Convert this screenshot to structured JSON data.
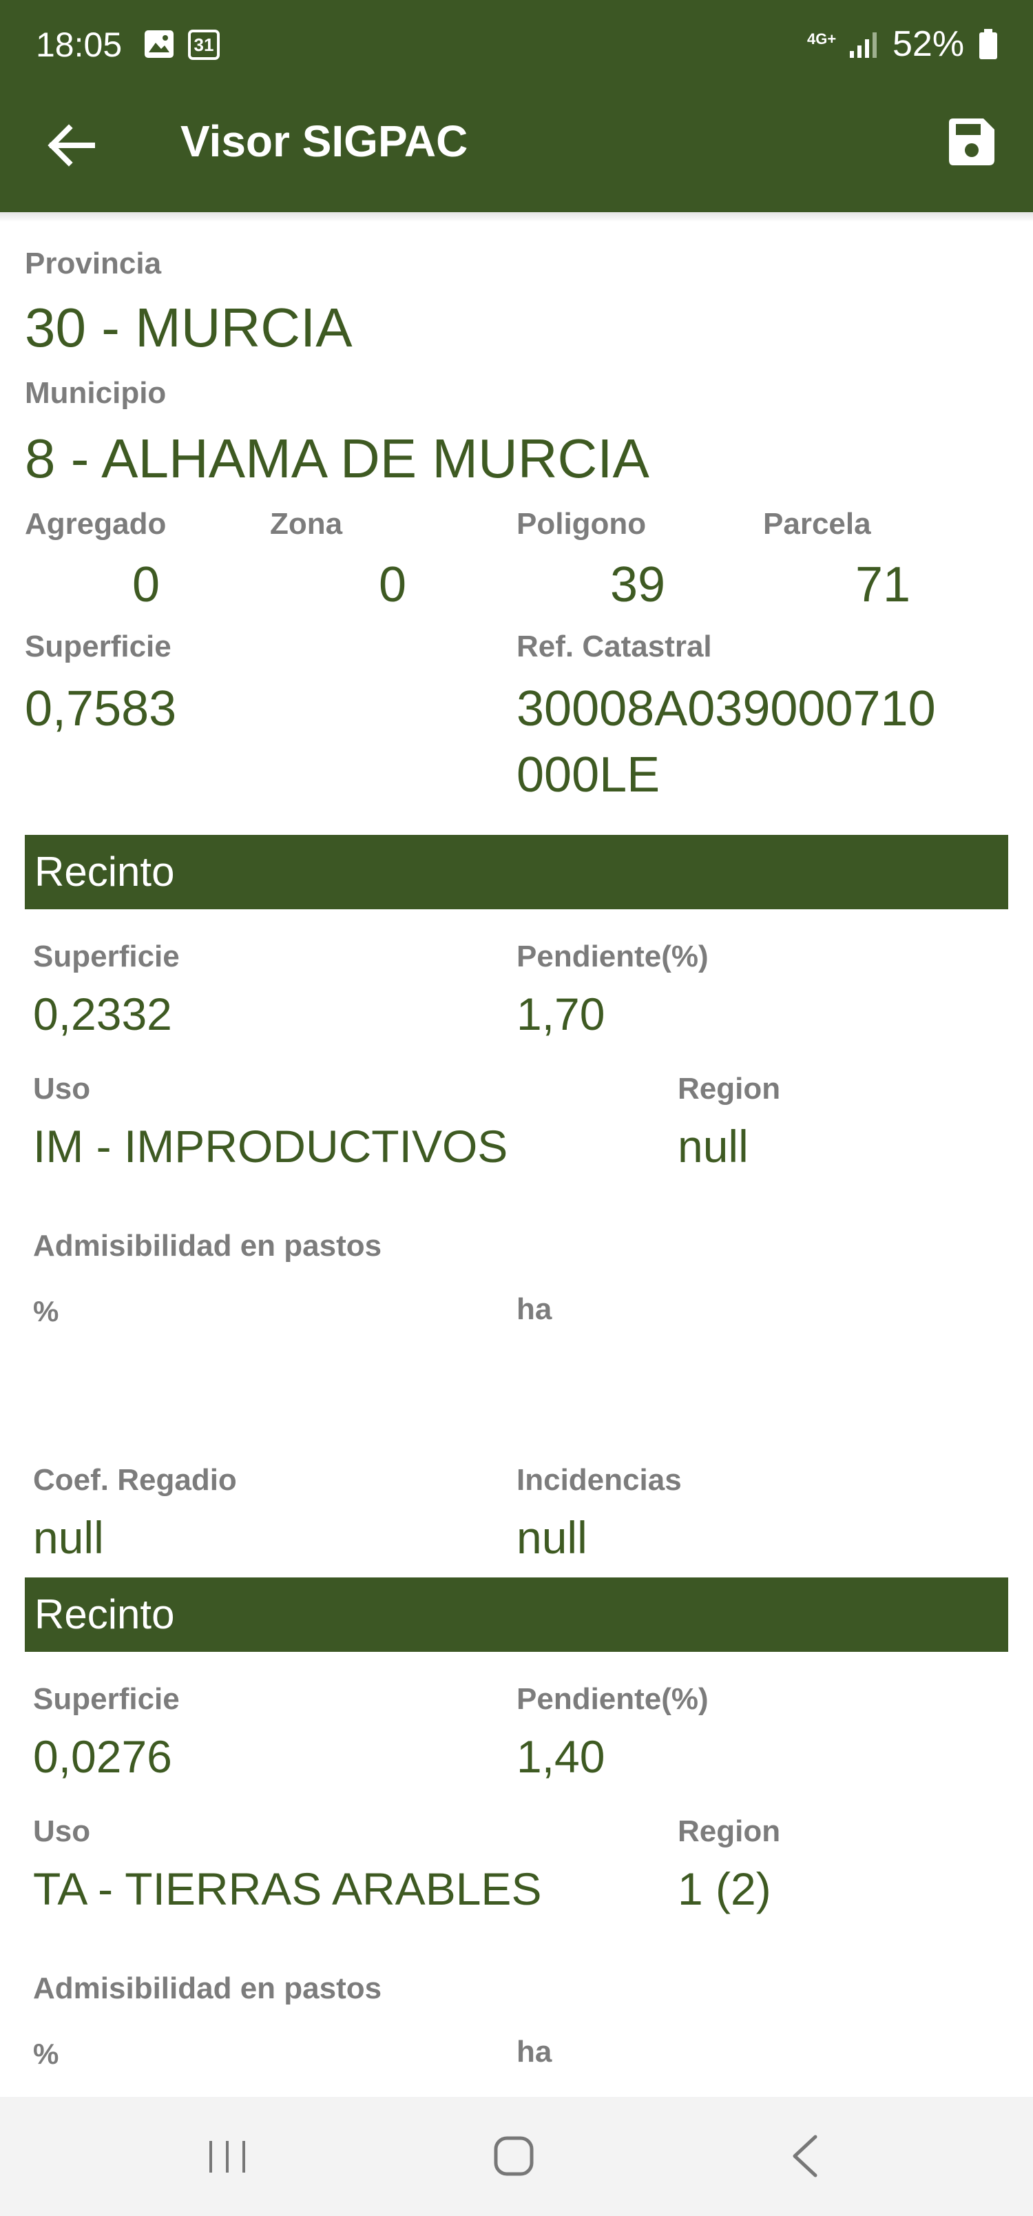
{
  "status_bar": {
    "time": "18:05",
    "calendar_day": "31",
    "network": "4G+",
    "battery": "52%"
  },
  "app_bar": {
    "title": "Visor SIGPAC"
  },
  "parcel": {
    "provincia_label": "Provincia",
    "provincia_value": "30 - MURCIA",
    "municipio_label": "Municipio",
    "municipio_value": "8 - ALHAMA DE MURCIA",
    "agregado_label": "Agregado",
    "agregado_value": "0",
    "zona_label": "Zona",
    "zona_value": "0",
    "poligono_label": "Poligono",
    "poligono_value": "39",
    "parcela_label": "Parcela",
    "parcela_value": "71",
    "superficie_label": "Superficie",
    "superficie_value": "0,7583",
    "refcat_label": "Ref. Catastral",
    "refcat_line1": "30008A039000710",
    "refcat_line2": "000LE"
  },
  "recintos": [
    {
      "header": "Recinto",
      "superficie_label": "Superficie",
      "superficie_value": "0,2332",
      "pendiente_label": "Pendiente(%)",
      "pendiente_value": "1,70",
      "uso_label": "Uso",
      "uso_value": "IM - IMPRODUCTIVOS",
      "region_label": "Region",
      "region_value": "null",
      "admisibilidad_label": "Admisibilidad en pastos",
      "pct_label": "%",
      "ha_label": "ha",
      "coef_label": "Coef. Regadio",
      "coef_value": "null",
      "incidencias_label": "Incidencias",
      "incidencias_value": "null"
    },
    {
      "header": "Recinto",
      "superficie_label": "Superficie",
      "superficie_value": "0,0276",
      "pendiente_label": "Pendiente(%)",
      "pendiente_value": "1,40",
      "uso_label": "Uso",
      "uso_value": "TA - TIERRAS ARABLES",
      "region_label": "Region",
      "region_value": "1 (2)",
      "admisibilidad_label": "Admisibilidad en pastos",
      "pct_label": "%",
      "ha_label": "ha"
    }
  ],
  "icons": {
    "back": "arrow-left-icon",
    "save": "floppy-disk-icon",
    "gallery": "image-icon",
    "calendar": "calendar-icon",
    "signal": "signal-icon",
    "battery": "battery-icon",
    "nav_recents": "recents-icon",
    "nav_home": "home-icon",
    "nav_back": "nav-back-icon"
  },
  "colors": {
    "primary": "#3c5724",
    "value_text": "#3e5a22",
    "label_text": "#7c7c7c"
  }
}
